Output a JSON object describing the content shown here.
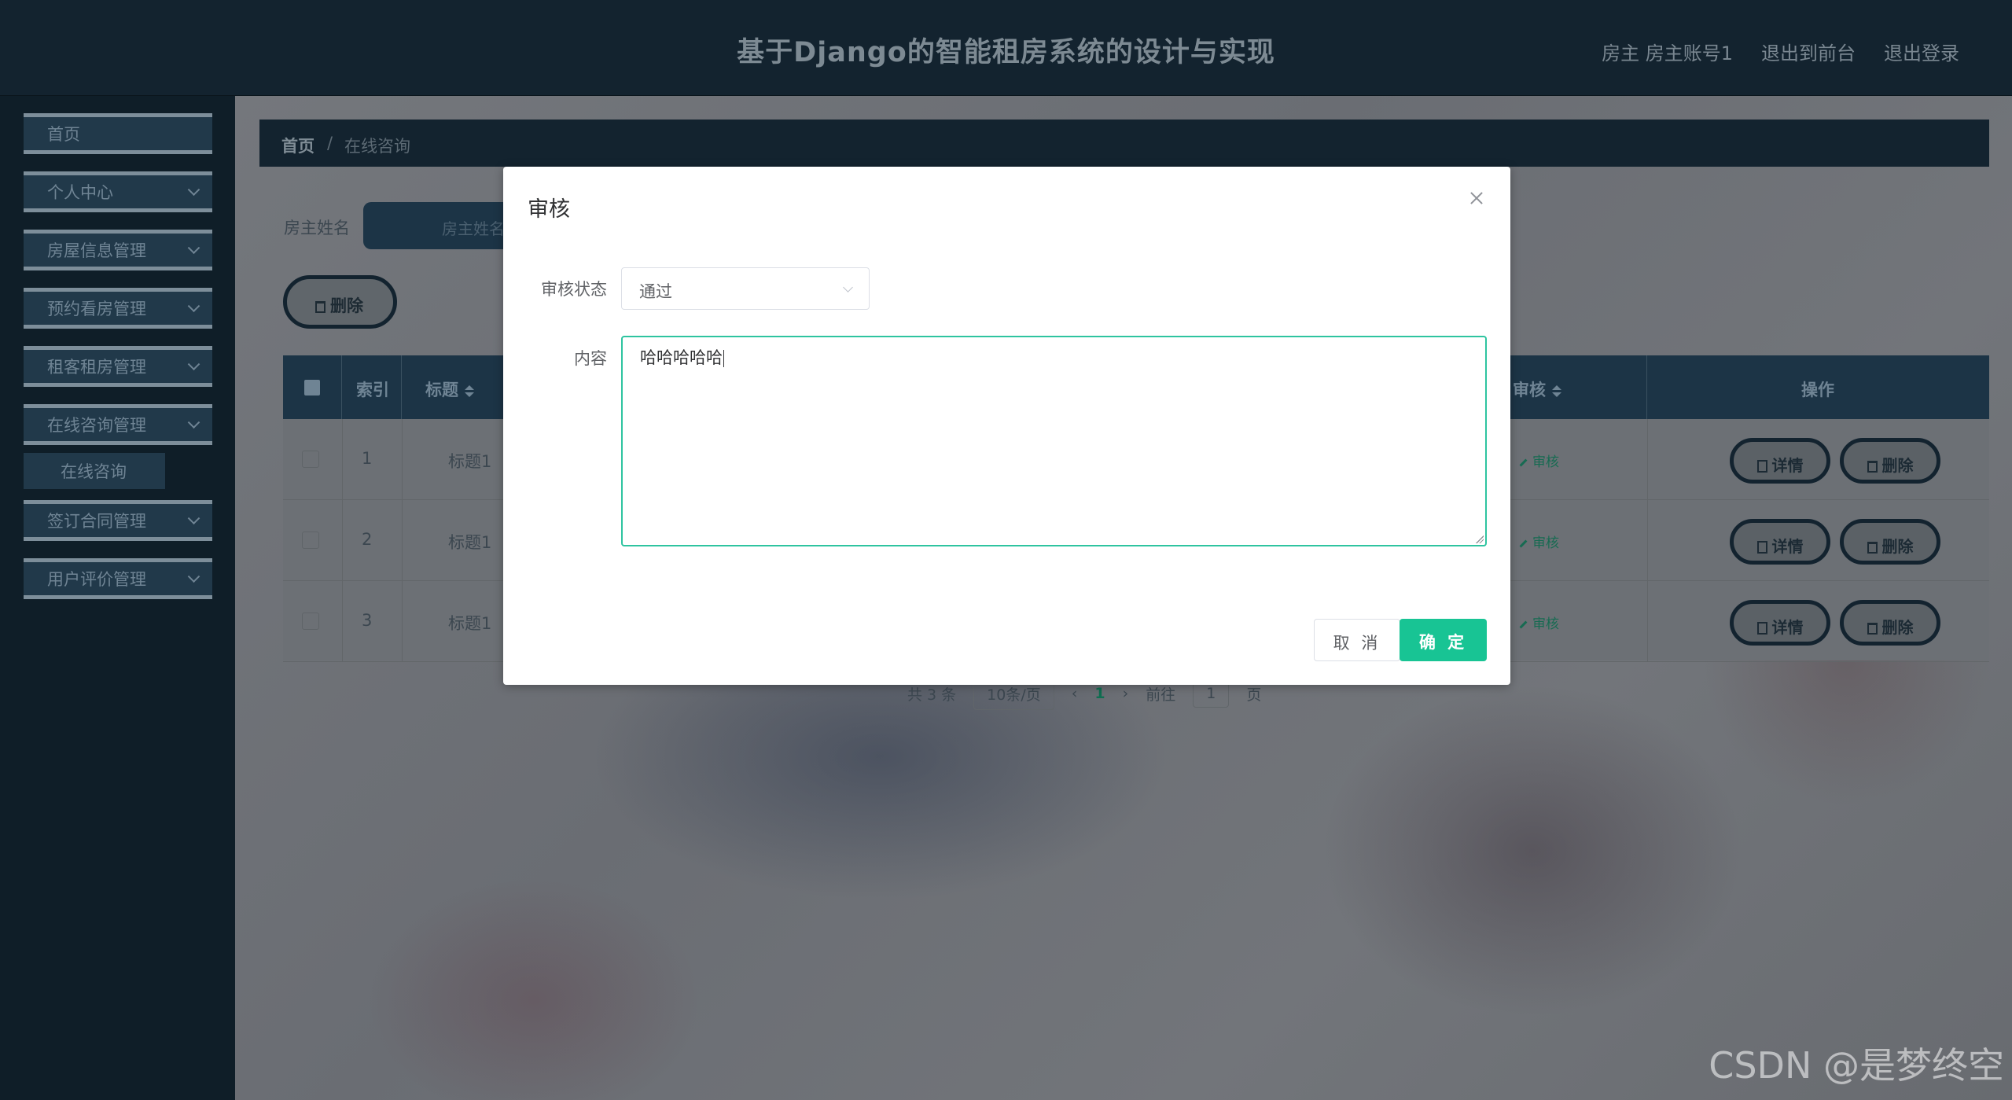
{
  "header": {
    "title": "基于Django的智能租房系统的设计与实现",
    "account": "房主 房主账号1",
    "to_front": "退出到前台",
    "logout": "退出登录"
  },
  "sidebar": {
    "items": [
      {
        "label": "首页"
      },
      {
        "label": "个人中心"
      },
      {
        "label": "房屋信息管理"
      },
      {
        "label": "预约看房管理"
      },
      {
        "label": "租客租房管理"
      },
      {
        "label": "在线咨询管理"
      },
      {
        "label": "签订合同管理"
      },
      {
        "label": "用户评价管理"
      }
    ],
    "submenu_active": "在线咨询"
  },
  "breadcrumb": {
    "home": "首页",
    "separator": "/",
    "current": "在线咨询"
  },
  "search": {
    "label": "房主姓名",
    "placeholder": "房主姓名"
  },
  "toolbar": {
    "delete_label": "删除"
  },
  "table": {
    "columns": {
      "index": "索引",
      "title": "标题",
      "audit": "审核",
      "actions": "操作"
    },
    "rows": [
      {
        "index": "1",
        "title": "标题1",
        "audit": "审核",
        "detail": "详情",
        "delete": "删除"
      },
      {
        "index": "2",
        "title": "标题1",
        "audit": "审核",
        "detail": "详情",
        "delete": "删除"
      },
      {
        "index": "3",
        "title": "标题1",
        "audit": "审核",
        "detail": "详情",
        "delete": "删除"
      }
    ]
  },
  "pagination": {
    "total": "共 3 条",
    "page_size": "10条/页",
    "current_page": "1",
    "goto_label": "前往",
    "goto_value": "1",
    "page_unit": "页"
  },
  "modal": {
    "title": "审核",
    "status_label": "审核状态",
    "status_value": "通过",
    "content_label": "内容",
    "content_value": "哈哈哈哈哈",
    "cancel_label": "取 消",
    "confirm_label": "确 定"
  },
  "watermark": "CSDN @是梦终空",
  "colors": {
    "header_bg": "#13232f",
    "sidebar_bg": "#0f1e28",
    "accent_green": "#18c494",
    "focus_border": "#2ec4a0"
  }
}
